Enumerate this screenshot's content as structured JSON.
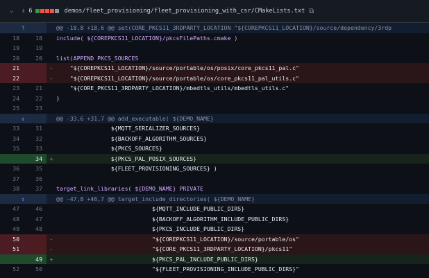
{
  "header": {
    "count": "6",
    "path": "demos/fleet_provisioning/fleet_provisioning_with_csr/CMakeLists.txt",
    "diffstat_colors": [
      "#2ea043",
      "#f85149",
      "#f85149",
      "#f85149",
      "#8b949e"
    ]
  },
  "rows": [
    {
      "type": "hunk",
      "text": "@@ -18,8 +18,6 @@ set(CORE_PKCS11_3RDPARTY_LOCATION \"${COREPKCS11_LOCATION}/source/dependency/3rdp",
      "icon": "expand-up-icon"
    },
    {
      "type": "ctx",
      "l": "18",
      "r": "18",
      "sign": "",
      "text": "include( ${COREPKCS11_LOCATION}/pkcsFilePaths.cmake )"
    },
    {
      "type": "ctx",
      "l": "19",
      "r": "19",
      "sign": "",
      "text": ""
    },
    {
      "type": "ctx",
      "l": "20",
      "r": "20",
      "sign": "",
      "text": "list(APPEND PKCS_SOURCES"
    },
    {
      "type": "del",
      "l": "21",
      "r": "",
      "sign": "-",
      "text": "    \"${COREPKCS11_LOCATION}/source/portable/os/posix/core_pkcs11_pal.c\""
    },
    {
      "type": "del",
      "l": "22",
      "r": "",
      "sign": "-",
      "text": "    \"${COREPKCS11_LOCATION}/source/portable/os/core_pkcs11_pal_utils.c\""
    },
    {
      "type": "ctx",
      "l": "23",
      "r": "21",
      "sign": "",
      "text": "    \"${CORE_PKCS11_3RDPARTY_LOCATION}/mbedtls_utils/mbedtls_utils.c\""
    },
    {
      "type": "ctx",
      "l": "24",
      "r": "22",
      "sign": "",
      "text": ")"
    },
    {
      "type": "ctx",
      "l": "25",
      "r": "23",
      "sign": "",
      "text": ""
    },
    {
      "type": "hunk",
      "text": "@@ -33,6 +31,7 @@ add_executable( ${DEMO_NAME}",
      "icon": "expand-both-icon"
    },
    {
      "type": "ctx",
      "l": "33",
      "r": "31",
      "sign": "",
      "text": "                ${MQTT_SERIALIZER_SOURCES}"
    },
    {
      "type": "ctx",
      "l": "34",
      "r": "32",
      "sign": "",
      "text": "                ${BACKOFF_ALGORITHM_SOURCES}"
    },
    {
      "type": "ctx",
      "l": "35",
      "r": "33",
      "sign": "",
      "text": "                ${PKCS_SOURCES}"
    },
    {
      "type": "add",
      "l": "",
      "r": "34",
      "sign": "+",
      "text": "                ${PKCS_PAL_POSIX_SOURCES}"
    },
    {
      "type": "ctx",
      "l": "36",
      "r": "35",
      "sign": "",
      "text": "                ${FLEET_PROVISIONING_SOURCES} )"
    },
    {
      "type": "ctx",
      "l": "37",
      "r": "36",
      "sign": "",
      "text": ""
    },
    {
      "type": "ctx",
      "l": "38",
      "r": "37",
      "sign": "",
      "text": "target_link_libraries( ${DEMO_NAME} PRIVATE"
    },
    {
      "type": "hunk",
      "text": "@@ -47,8 +46,7 @@ target_include_directories( ${DEMO_NAME}",
      "icon": "expand-both-icon"
    },
    {
      "type": "ctx",
      "l": "47",
      "r": "46",
      "sign": "",
      "text": "                            ${MQTT_INCLUDE_PUBLIC_DIRS}"
    },
    {
      "type": "ctx",
      "l": "48",
      "r": "47",
      "sign": "",
      "text": "                            ${BACKOFF_ALGORITHM_INCLUDE_PUBLIC_DIRS}"
    },
    {
      "type": "ctx",
      "l": "49",
      "r": "48",
      "sign": "",
      "text": "                            ${PKCS_INCLUDE_PUBLIC_DIRS}"
    },
    {
      "type": "del",
      "l": "50",
      "r": "",
      "sign": "-",
      "text": "                            \"${COREPKCS11_LOCATION}/source/portable/os\""
    },
    {
      "type": "del",
      "l": "51",
      "r": "",
      "sign": "-",
      "text": "                            \"${CORE_PKCS11_3RDPARTY_LOCATION}/pkcs11\""
    },
    {
      "type": "add",
      "l": "",
      "r": "49",
      "sign": "+",
      "text": "                            ${PKCS_PAL_INCLUDE_PUBLIC_DIRS}"
    },
    {
      "type": "ctx",
      "l": "52",
      "r": "50",
      "sign": "",
      "text": "                            \"${FLEET_PROVISIONING_INCLUDE_PUBLIC_DIRS}\""
    }
  ]
}
